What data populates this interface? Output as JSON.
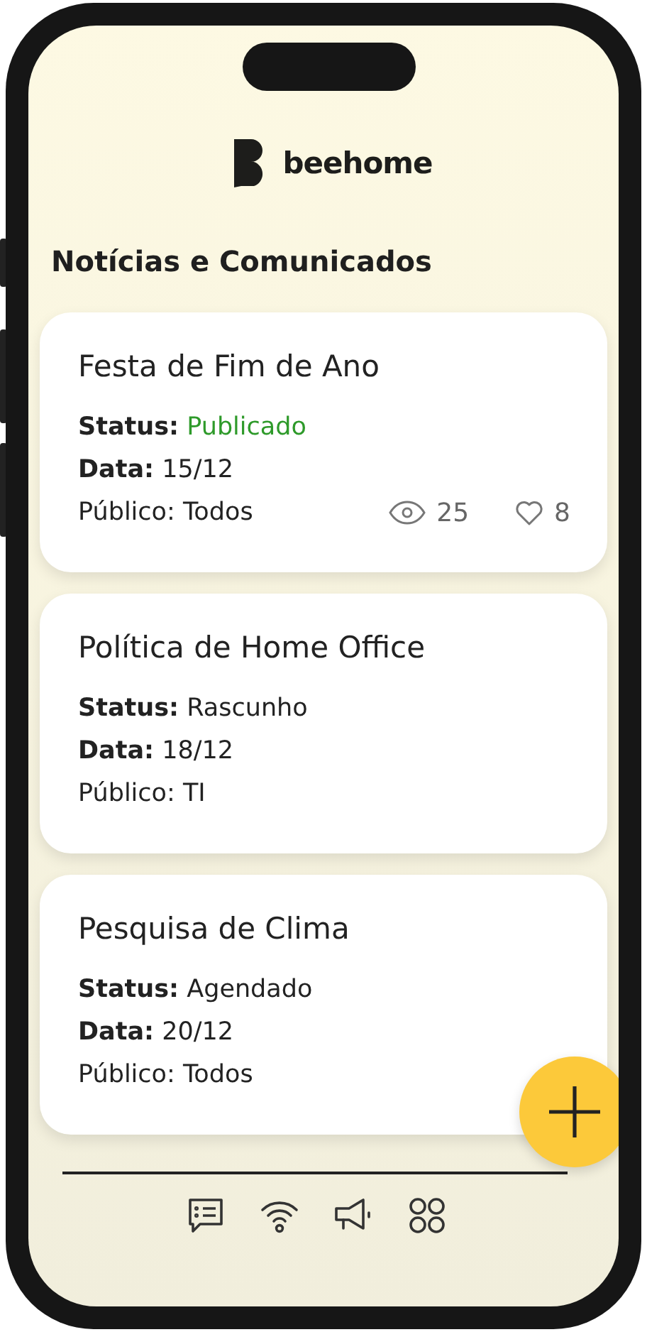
{
  "app": {
    "logo_text": "beehome"
  },
  "heading": "Notícias e Comunicados",
  "posts": [
    {
      "title": "Festa de Fim de Ano",
      "status": {
        "label": "Status:",
        "value": "Publicado",
        "color": "#2e9a2a"
      },
      "date": {
        "label": "Data:",
        "value": "15/12"
      },
      "audience": "Público: Todos",
      "views": "25",
      "likes": "8"
    },
    {
      "title": "Política de Home Office",
      "status": {
        "label": "Status:",
        "value": "Rascunho",
        "color": "#222222"
      },
      "date": {
        "label": "Data:",
        "value": "18/12"
      },
      "audience": "Público: TI"
    },
    {
      "title": "Pesquisa de Clima",
      "status": {
        "label": "Status:",
        "value": "Agendado",
        "color": "#222222"
      },
      "date": {
        "label": "Data:",
        "value": "20/12"
      },
      "audience": "Público: Todos"
    }
  ],
  "nav": [
    {
      "kind": "messages"
    },
    {
      "kind": "signal"
    },
    {
      "kind": "announce"
    },
    {
      "kind": "apps"
    }
  ]
}
